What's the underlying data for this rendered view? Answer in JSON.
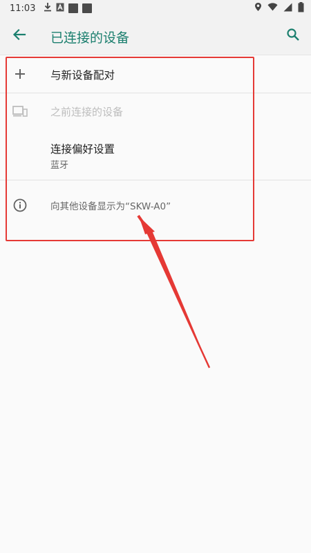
{
  "status_bar": {
    "time": "11:03"
  },
  "app_bar": {
    "title": "已连接的设备"
  },
  "list": {
    "pair_new_label": "与新设备配对",
    "previously_connected_label": "之前连接的设备",
    "connection_prefs_label": "连接偏好设置",
    "connection_prefs_sub": "蓝牙",
    "visible_as_label": "向其他设备显示为“SKW-A0”"
  },
  "colors": {
    "accent": "#1b7f6e",
    "annotation": "#e53935"
  },
  "icons": {
    "back": "arrow-back-icon",
    "search": "search-icon",
    "add": "plus-icon",
    "devices": "devices-icon",
    "info": "info-icon"
  }
}
